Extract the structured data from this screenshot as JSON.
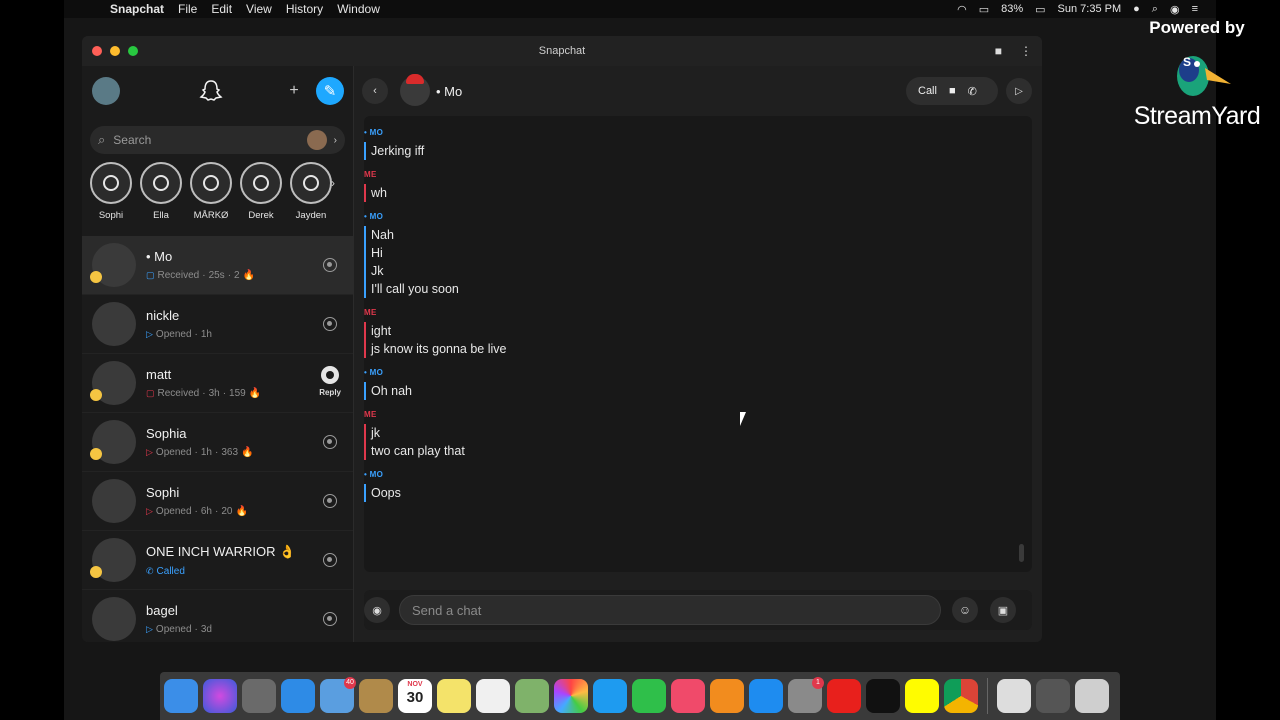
{
  "menubar": {
    "app_name": "Snapchat",
    "items": [
      "File",
      "Edit",
      "View",
      "History",
      "Window"
    ],
    "battery": "83%",
    "clock": "Sun 7:35 PM"
  },
  "stream_badge": {
    "powered": "Powered by",
    "brand": "StreamYard"
  },
  "window": {
    "title": "Snapchat"
  },
  "sidebar": {
    "search_placeholder": "Search",
    "stories": [
      "Sophi",
      "Ella",
      "MÅRKØ",
      "Derek",
      "Jayden"
    ],
    "conversations": [
      {
        "name": "• Mo",
        "status": "Received",
        "time": "25s",
        "streak": "2",
        "status_color": "blue",
        "action": "camera"
      },
      {
        "name": "nickle",
        "status": "Opened",
        "time": "1h",
        "streak": "",
        "status_color": "blue",
        "action": "camera"
      },
      {
        "name": "matt",
        "status": "Received",
        "time": "3h",
        "streak": "159",
        "status_color": "red",
        "action": "reply",
        "action_label": "Reply"
      },
      {
        "name": "Sophia",
        "status": "Opened",
        "time": "1h",
        "streak": "363",
        "status_color": "red",
        "action": "camera"
      },
      {
        "name": "Sophi",
        "status": "Opened",
        "time": "6h",
        "streak": "20",
        "status_color": "red",
        "action": "camera"
      },
      {
        "name": "ONE INCH WARRIOR 👌",
        "status": "Called",
        "time": "",
        "streak": "",
        "status_color": "blue",
        "action": "camera"
      },
      {
        "name": "bagel",
        "status": "Opened",
        "time": "3d",
        "streak": "",
        "status_color": "blue",
        "action": "camera"
      }
    ]
  },
  "chat": {
    "contact": "• Mo",
    "call_label": "Call",
    "composer_placeholder": "Send a chat",
    "messages": [
      {
        "sender": "• MO",
        "from": "mo",
        "lines": [
          "Jerking iff"
        ]
      },
      {
        "sender": "ME",
        "from": "me",
        "lines": [
          "wh"
        ]
      },
      {
        "sender": "• MO",
        "from": "mo",
        "lines": [
          "Nah",
          "Hi",
          "Jk",
          "I'll call you soon"
        ]
      },
      {
        "sender": "ME",
        "from": "me",
        "lines": [
          "ight",
          "js know its gonna be live"
        ]
      },
      {
        "sender": "• MO",
        "from": "mo",
        "lines": [
          "Oh nah"
        ]
      },
      {
        "sender": "ME",
        "from": "me",
        "lines": [
          "jk",
          "two can play that"
        ]
      },
      {
        "sender": "• MO",
        "from": "mo",
        "lines": [
          "Oops"
        ]
      }
    ]
  },
  "dock": {
    "calendar_month": "NOV",
    "calendar_day": "30",
    "mail_badge": "40",
    "prefs_badge": "1"
  },
  "colors": {
    "accent_blue": "#3aa1ff",
    "accent_red": "#e0384c",
    "newchat_blue": "#1ea8ff"
  }
}
